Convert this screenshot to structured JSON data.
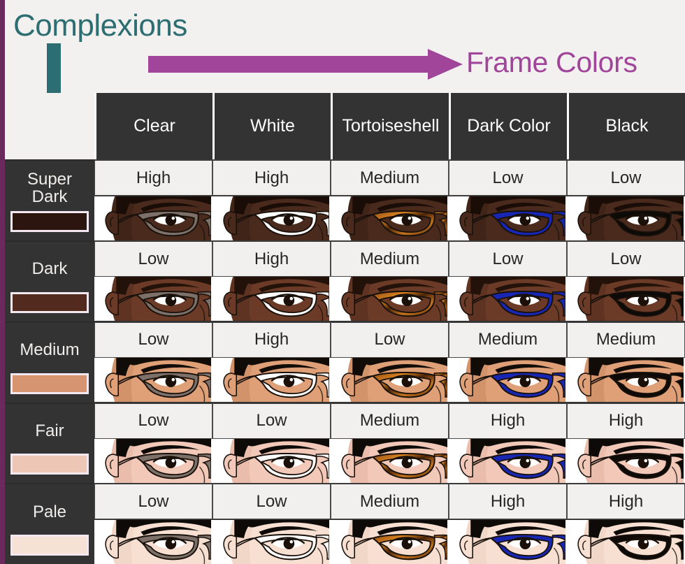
{
  "header": {
    "row_axis_title": "Complexions",
    "col_axis_title": "Frame Colors",
    "row_arrow_icon": "arrow-down-icon",
    "col_arrow_icon": "arrow-right-icon",
    "row_arrow_color": "#2d6e72",
    "col_arrow_color": "#a0459a",
    "border_color": "#6b2a5e"
  },
  "columns": [
    {
      "label": "Clear",
      "frame_color": "#7d7068"
    },
    {
      "label": "White",
      "frame_color": "#ffffff"
    },
    {
      "label": "Tortoiseshell",
      "frame_color": "#6b3a16"
    },
    {
      "label": "Dark Color",
      "frame_color": "#1826b4"
    },
    {
      "label": "Black",
      "frame_color": "#0d0a08"
    }
  ],
  "rows": [
    {
      "label": "Super Dark",
      "swatch": "#2c150e",
      "skin": "#4a2a1c",
      "skin_shadow": "#361d13",
      "hair": "#1a0d07",
      "brow": "#1a0d07",
      "ratings": [
        "High",
        "High",
        "Medium",
        "Low",
        "Low"
      ]
    },
    {
      "label": "Dark",
      "swatch": "#532a1e",
      "skin": "#6b3b27",
      "skin_shadow": "#4f2a1a",
      "hair": "#231209",
      "brow": "#231209",
      "ratings": [
        "Low",
        "High",
        "Medium",
        "Low",
        "Low"
      ]
    },
    {
      "label": "Medium",
      "swatch": "#d79471",
      "skin": "#e0a077",
      "skin_shadow": "#c1815a",
      "hair": "#120c08",
      "brow": "#120c08",
      "ratings": [
        "Low",
        "High",
        "Low",
        "Medium",
        "Medium"
      ]
    },
    {
      "label": "Fair",
      "swatch": "#eec6b6",
      "skin": "#f2c8b8",
      "skin_shadow": "#dfae9c",
      "hair": "#0d0a08",
      "brow": "#0d0a08",
      "ratings": [
        "Low",
        "Low",
        "Medium",
        "High",
        "High"
      ]
    },
    {
      "label": "Pale",
      "swatch": "#f5e2d5",
      "skin": "#f7e0d2",
      "skin_shadow": "#e6cbbb",
      "hair": "#0d0a08",
      "brow": "#0d0a08",
      "ratings": [
        "Low",
        "Low",
        "Medium",
        "High",
        "High"
      ]
    }
  ],
  "legend": {
    "rating_values": [
      "High",
      "Medium",
      "Low"
    ]
  }
}
